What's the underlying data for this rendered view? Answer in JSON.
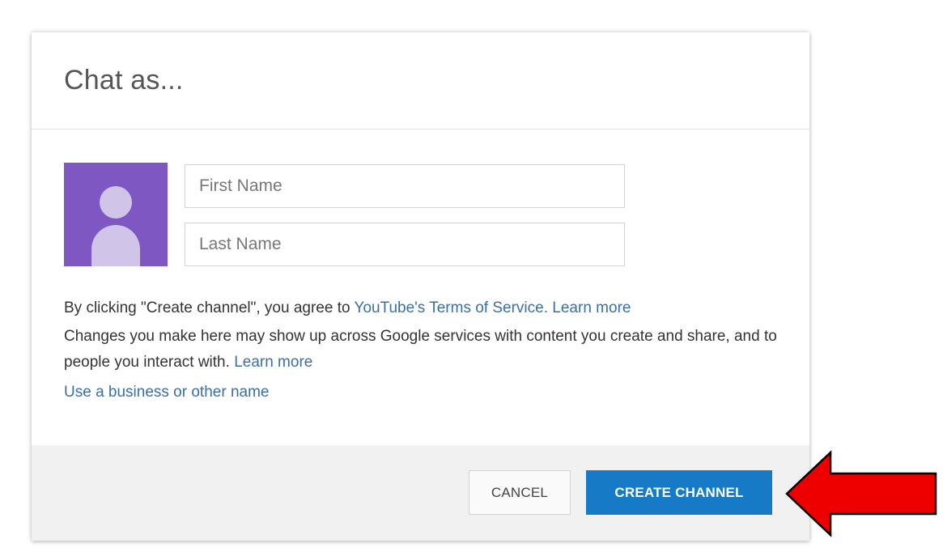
{
  "dialog": {
    "title": "Chat as...",
    "avatar_icon": "person-icon",
    "first_name": {
      "value": "",
      "placeholder": "First Name"
    },
    "last_name": {
      "value": "",
      "placeholder": "Last Name"
    },
    "legal": {
      "line1_prefix": "By clicking \"Create channel\", you agree to ",
      "terms_link": "YouTube's Terms of Service.",
      "line1_learn_more": "Learn more",
      "line2_text": "Changes you make here may show up across Google services with content you create and share, and to people you interact with.",
      "line2_learn_more": "Learn more",
      "business_link": "Use a business or other name"
    },
    "buttons": {
      "cancel_label": "CANCEL",
      "create_label": "CREATE CHANNEL"
    }
  },
  "annotation": {
    "arrow_icon": "left-pointing-arrow-icon",
    "arrow_color": "#ee0000"
  },
  "colors": {
    "accent": "#167ac6",
    "link": "#3a6fa6",
    "avatar_bg": "#7e57c2",
    "avatar_fg": "#d1c4e9"
  }
}
